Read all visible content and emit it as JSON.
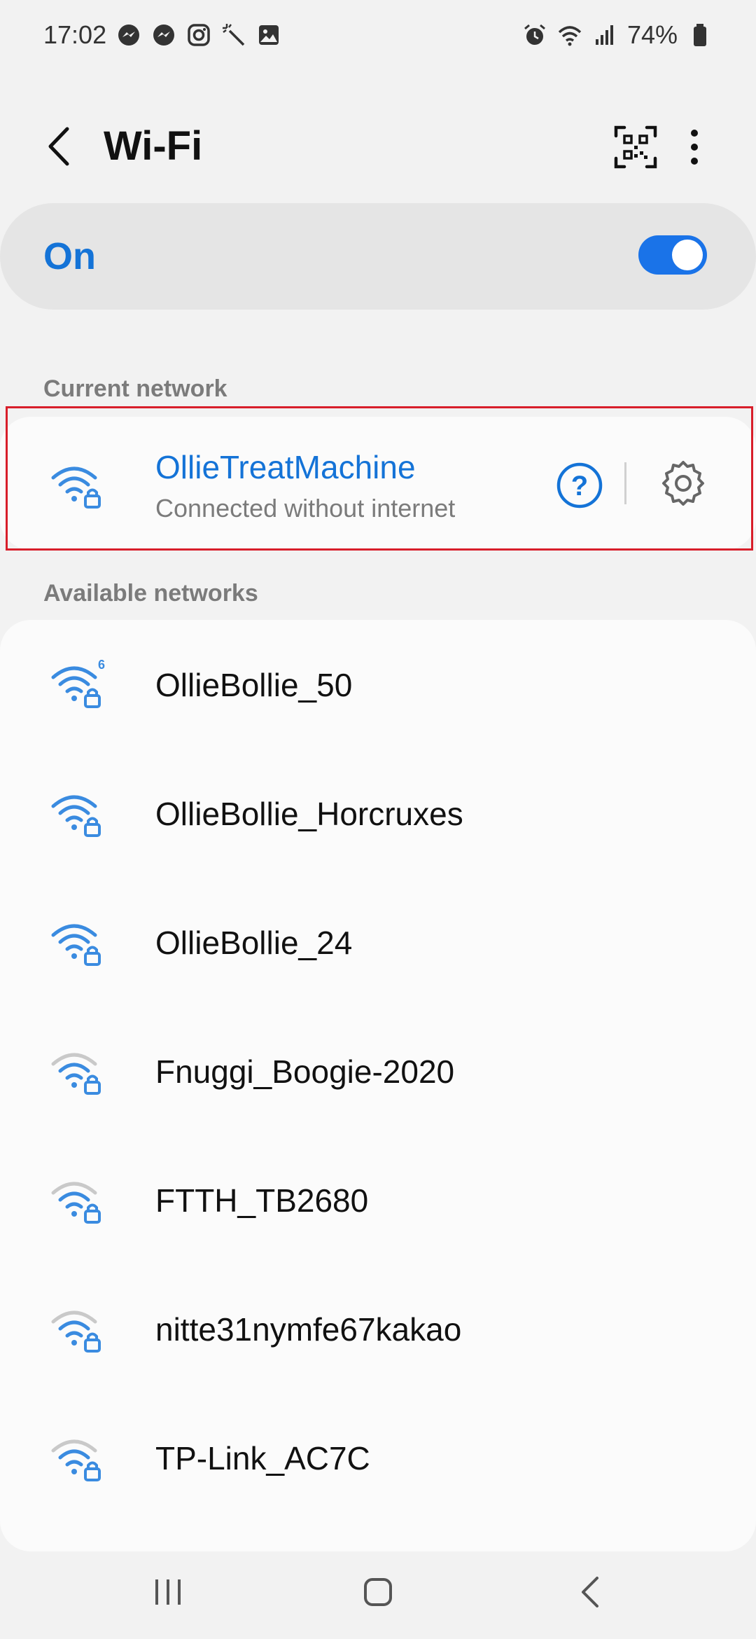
{
  "status_bar": {
    "time": "17:02",
    "battery": "74%",
    "left_icons": [
      "messenger-icon",
      "messenger-icon",
      "instagram-icon",
      "magic-wand-icon",
      "gallery-icon"
    ],
    "right_icons": [
      "alarm-icon",
      "wifi-status-icon",
      "signal-icon",
      "battery-icon"
    ]
  },
  "header": {
    "title": "Wi-Fi"
  },
  "master_switch": {
    "label": "On",
    "enabled": true
  },
  "current_network": {
    "section_label": "Current network",
    "name": "OllieTreatMachine",
    "status": "Connected without internet"
  },
  "available_networks": {
    "section_label": "Available networks",
    "items": [
      {
        "name": "OllieBollie_50",
        "strength": "full",
        "badge": "6"
      },
      {
        "name": "OllieBollie_Horcruxes",
        "strength": "full"
      },
      {
        "name": "OllieBollie_24",
        "strength": "full"
      },
      {
        "name": "Fnuggi_Boogie-2020",
        "strength": "weak"
      },
      {
        "name": "FTTH_TB2680",
        "strength": "weak"
      },
      {
        "name": "nitte31nymfe67kakao",
        "strength": "weak"
      },
      {
        "name": "TP-Link_AC7C",
        "strength": "weak"
      }
    ]
  },
  "colors": {
    "accent": "#1473d7",
    "toggle": "#1a73e8",
    "highlight": "#d81e2a"
  }
}
